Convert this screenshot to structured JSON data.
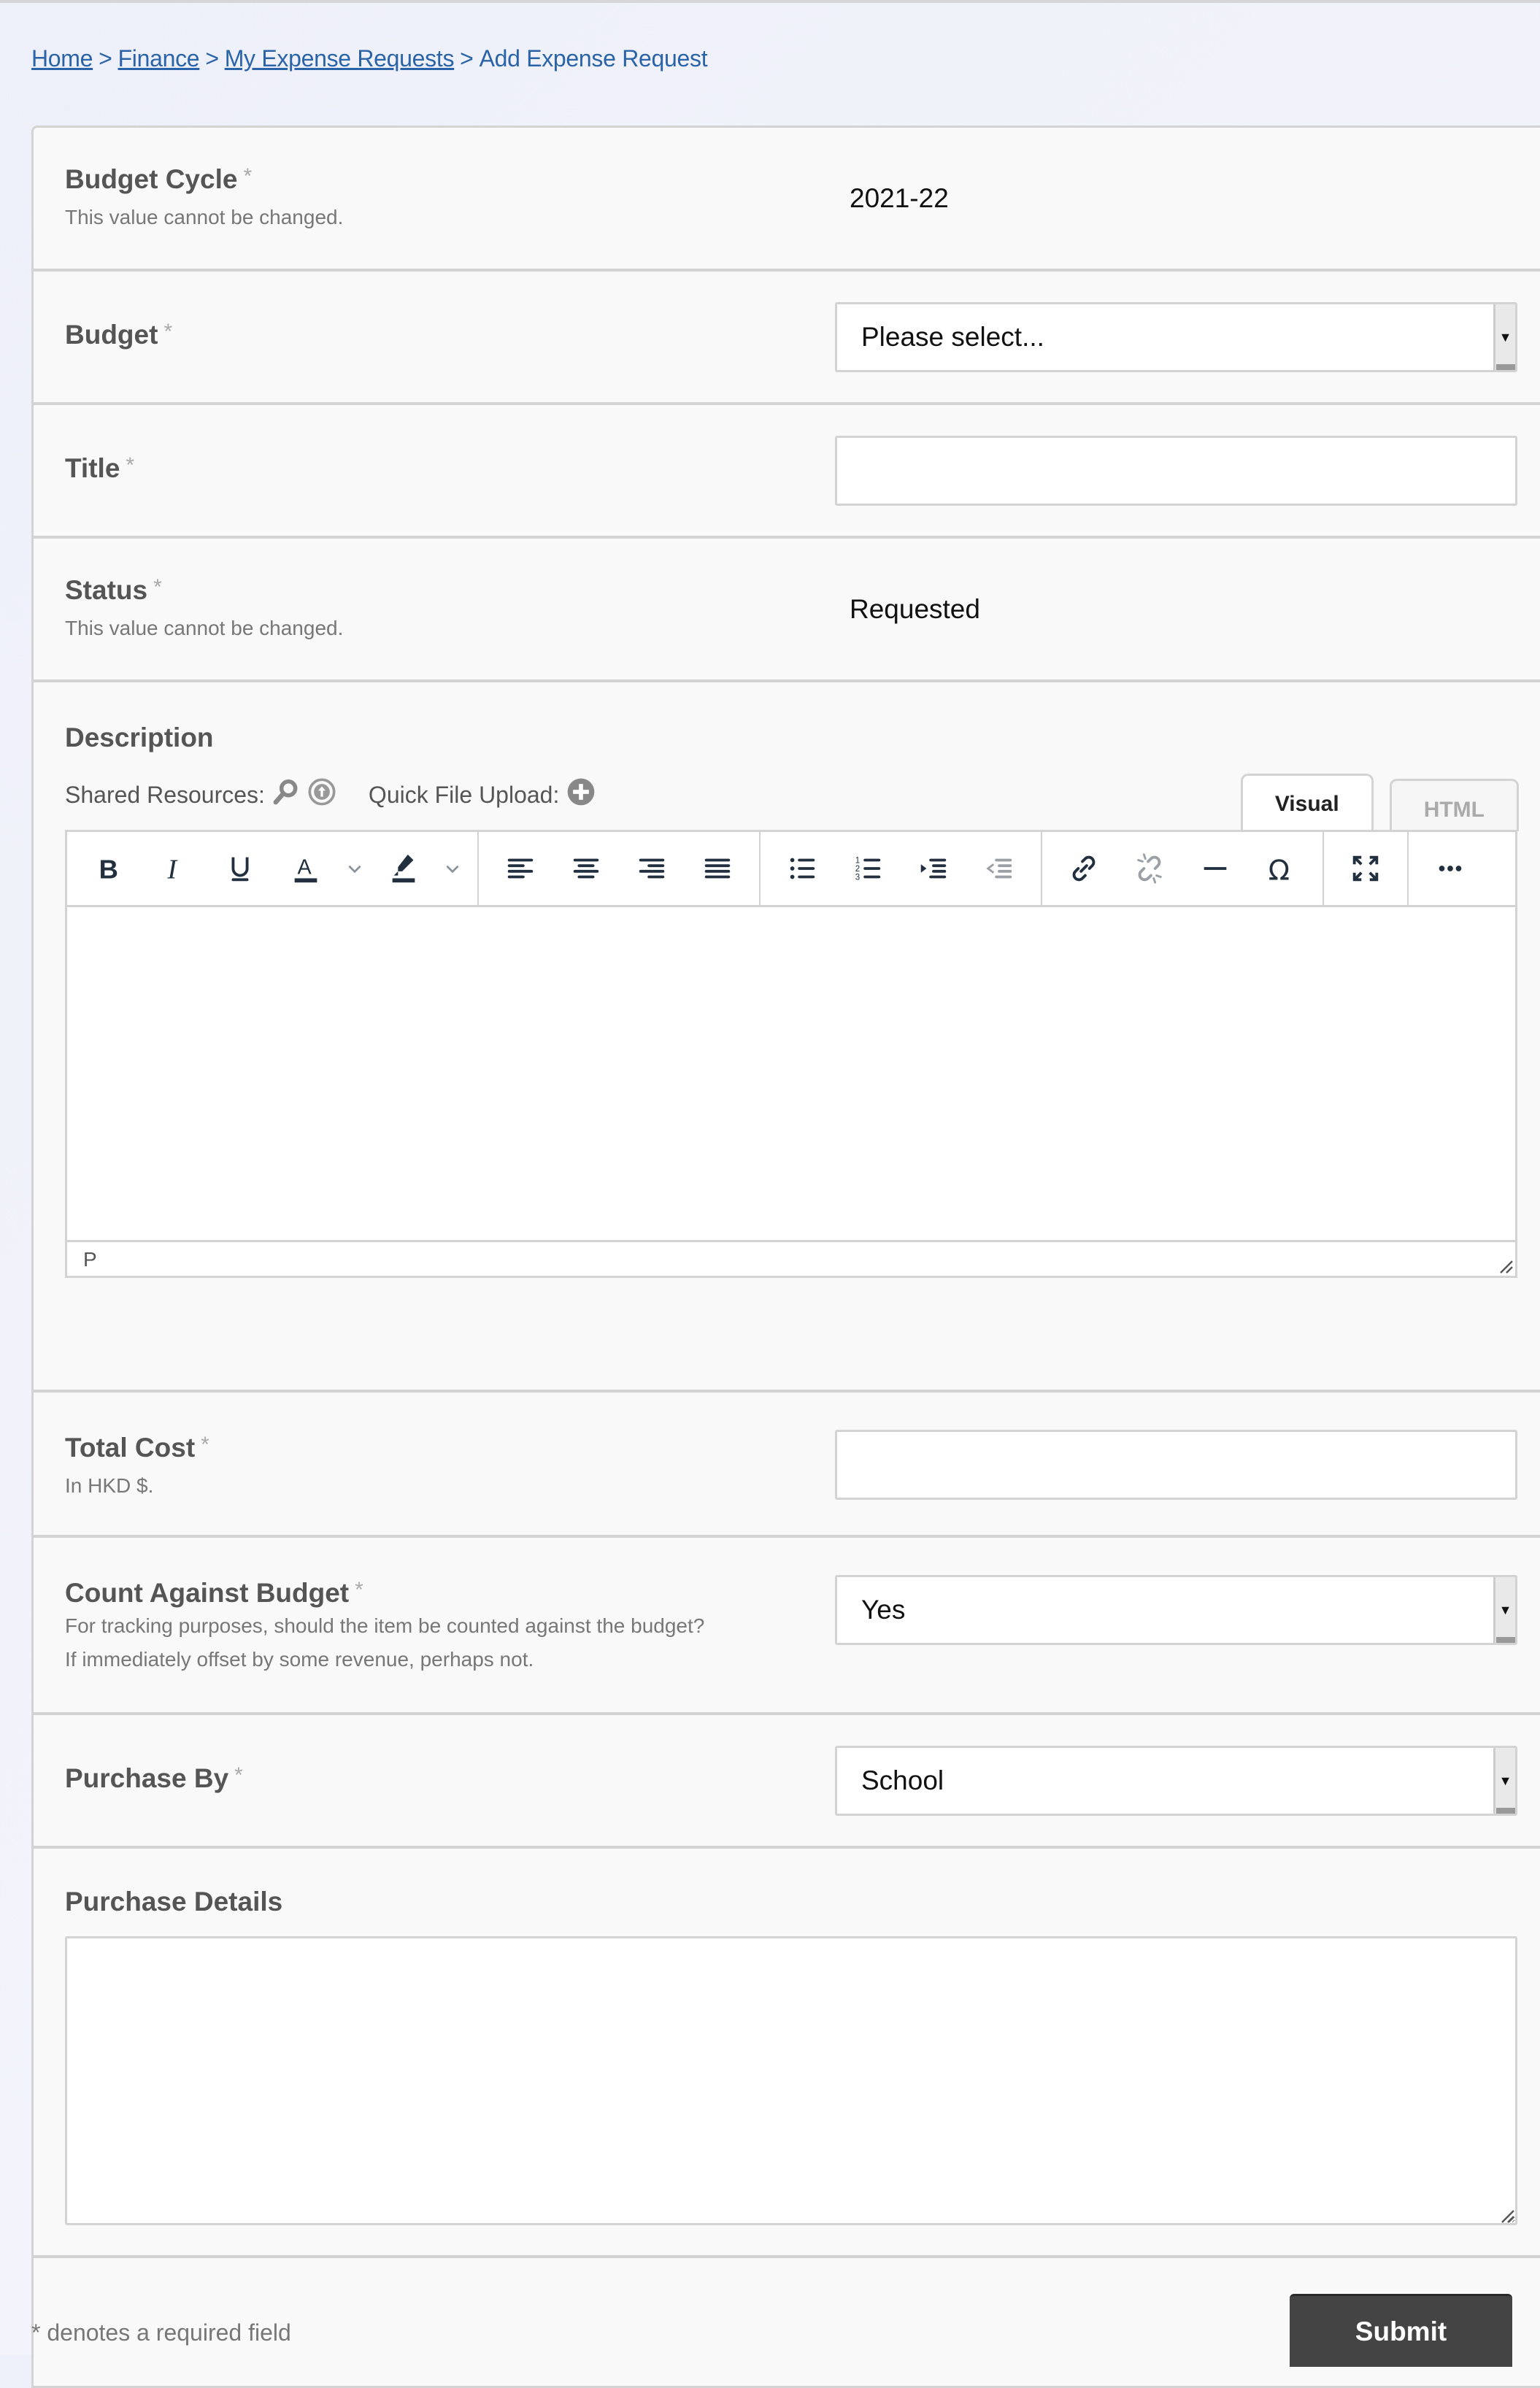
{
  "breadcrumb": {
    "items": [
      {
        "label": "Home",
        "link": true
      },
      {
        "label": "Finance",
        "link": true
      },
      {
        "label": "My Expense Requests",
        "link": true
      },
      {
        "label": "Add Expense Request",
        "link": false
      }
    ],
    "separator": ">"
  },
  "form": {
    "required_marker": "*",
    "budget_cycle": {
      "label": "Budget Cycle",
      "hint": "This value cannot be changed.",
      "value": "2021-22"
    },
    "budget": {
      "label": "Budget",
      "selected": "Please select..."
    },
    "title": {
      "label": "Title",
      "value": ""
    },
    "status": {
      "label": "Status",
      "hint": "This value cannot be changed.",
      "value": "Requested"
    },
    "description": {
      "label": "Description",
      "shared_resources_label": "Shared Resources:",
      "quick_upload_label": "Quick File Upload:",
      "tabs": [
        {
          "label": "Visual",
          "active": true
        },
        {
          "label": "HTML",
          "active": false
        }
      ],
      "toolbar": [
        "bold",
        "italic",
        "underline",
        "text-color",
        "text-color-dropdown",
        "highlight",
        "highlight-dropdown",
        "align-left",
        "align-center",
        "align-right",
        "justify",
        "bullet-list",
        "numbered-list",
        "indent",
        "outdent",
        "link",
        "unlink",
        "horizontal-rule",
        "special-character",
        "fullscreen",
        "more"
      ],
      "statusbar_path": "P",
      "content": ""
    },
    "total_cost": {
      "label": "Total Cost",
      "hint": "In HKD $.",
      "value": ""
    },
    "count_against_budget": {
      "label": "Count Against Budget",
      "hint": "For tracking purposes, should the item be counted against the budget? If immediately offset by some revenue, perhaps not.",
      "selected": "Yes"
    },
    "purchase_by": {
      "label": "Purchase By",
      "selected": "School"
    },
    "purchase_details": {
      "label": "Purchase Details",
      "value": ""
    },
    "footer_note": "* denotes a required field",
    "submit_label": "Submit"
  },
  "colors": {
    "link": "#2a63a8",
    "submit_bg": "#444444",
    "icon_dark": "#222f3e",
    "icon_disabled": "#9aa0a6"
  }
}
